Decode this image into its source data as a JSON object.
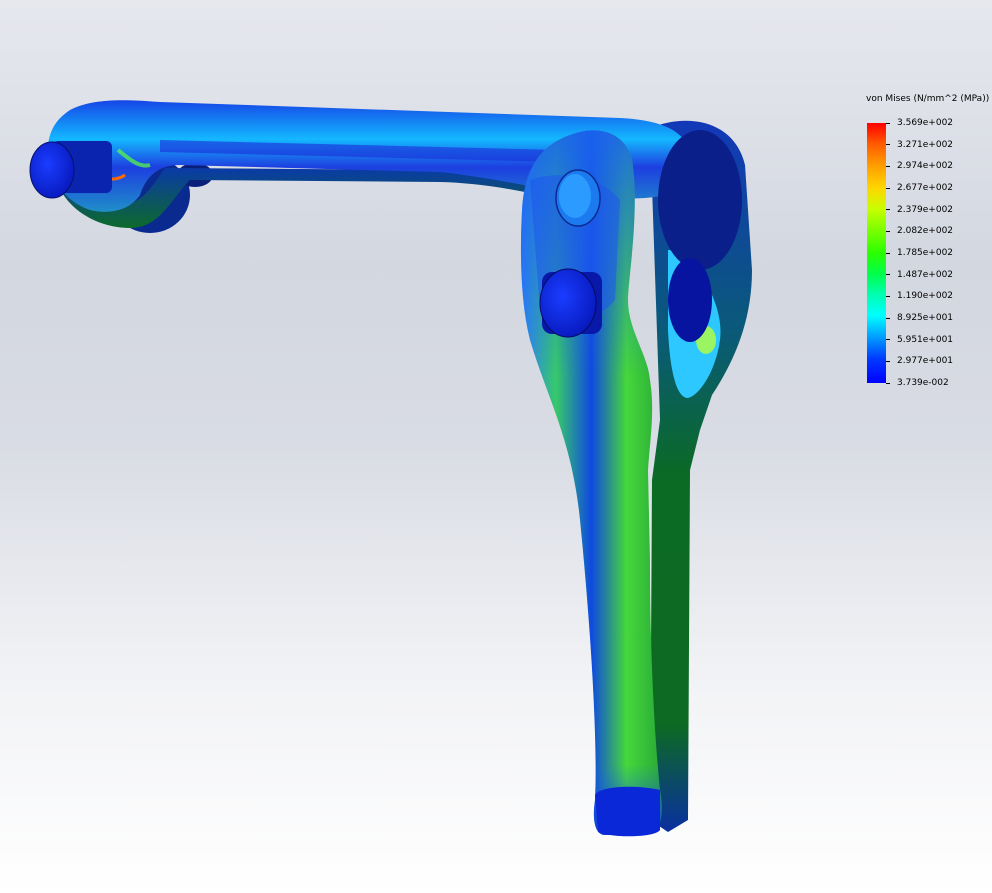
{
  "legend": {
    "title": "von Mises (N/mm^2 (MPa))",
    "values": [
      "3.569e+002",
      "3.271e+002",
      "2.974e+002",
      "2.677e+002",
      "2.379e+002",
      "2.082e+002",
      "1.785e+002",
      "1.487e+002",
      "1.190e+002",
      "8.925e+001",
      "5.951e+001",
      "2.977e+001",
      "3.739e-002"
    ]
  },
  "colors": {
    "max": "#ff0000",
    "min": "#0000ff",
    "background_top": "#d5d9e2",
    "background_bottom": "#ffffff"
  },
  "icons": {
    "model": "stress-contour-part"
  }
}
